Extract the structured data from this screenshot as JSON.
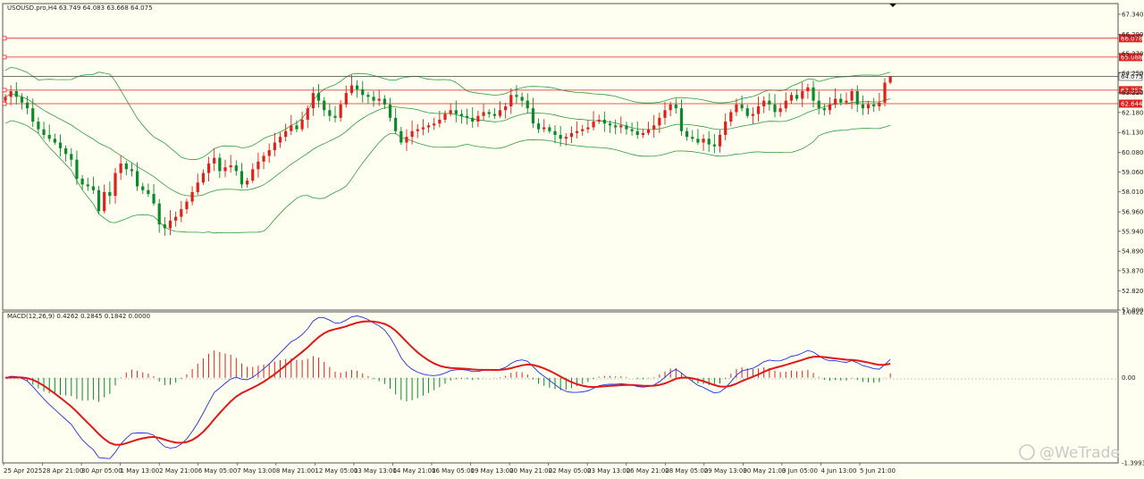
{
  "header": {
    "symbol_line": "USOUSD.pro,H4  63.749 64.083 63.668 64.075",
    "macd_line": "MACD(12,26,9) 0.4262 0.2845 0.1842 0.0000"
  },
  "watermark": "@WeTrade",
  "colors": {
    "background": "#fefff0",
    "bull": "#e0201c",
    "bear": "#0a8a2a",
    "bollinger": "#2e9e3e",
    "level": "#e02020",
    "price_line": "#444444",
    "macd": "#2030e0",
    "signal": "#e01818"
  },
  "chart_data": [
    {
      "type": "candlestick",
      "symbol": "USOUSD.pro",
      "timeframe": "H4",
      "ohlc_current": {
        "open": 63.749,
        "high": 64.083,
        "low": 63.668,
        "close": 64.075
      },
      "ylim": [
        51.8,
        67.9
      ],
      "y_ticks": [
        "67.340",
        "66.290",
        "65.270",
        "64.250",
        "63.220",
        "62.180",
        "61.130",
        "60.080",
        "59.060",
        "58.010",
        "56.960",
        "55.940",
        "54.890",
        "53.870",
        "52.820",
        "51.800"
      ],
      "x_ticks": [
        "25 Apr 2025",
        "28 Apr 21:00",
        "30 Apr 05:00",
        "1 May 13:00",
        "2 May 21:00",
        "6 May 05:00",
        "7 May 13:00",
        "8 May 21:00",
        "12 May 05:00",
        "13 May 13:00",
        "14 May 21:00",
        "16 May 05:00",
        "19 May 13:00",
        "20 May 21:00",
        "22 May 05:00",
        "23 May 13:00",
        "26 May 21:00",
        "28 May 05:00",
        "29 May 13:00",
        "30 May 21:00",
        "3 Jun 05:00",
        "4 Jun 13:00",
        "5 Jun 21:00"
      ],
      "levels": [
        {
          "value": 66.078,
          "label": "66.078"
        },
        {
          "value": 65.088,
          "label": "65.088"
        },
        {
          "value": 63.352,
          "label": "63.352"
        },
        {
          "value": 62.644,
          "label": "62.644"
        }
      ],
      "last_price": {
        "value": 64.075,
        "label": "64.075"
      },
      "close": [
        63.0,
        63.3,
        63.0,
        62.7,
        62.4,
        61.7,
        61.3,
        61.0,
        60.8,
        60.6,
        60.3,
        60.0,
        59.7,
        58.7,
        58.4,
        58.3,
        58.1,
        57.0,
        58.0,
        57.8,
        59.0,
        59.5,
        59.2,
        59.1,
        58.3,
        58.1,
        57.9,
        57.4,
        56.3,
        56.1,
        56.5,
        56.7,
        57.1,
        57.5,
        58.0,
        58.5,
        59.0,
        59.5,
        59.8,
        59.1,
        59.3,
        59.4,
        59.1,
        58.4,
        58.6,
        59.2,
        59.6,
        59.9,
        60.2,
        60.6,
        60.9,
        61.2,
        61.5,
        61.3,
        61.8,
        62.4,
        63.2,
        62.8,
        62.3,
        62.0,
        61.9,
        62.6,
        63.2,
        63.6,
        63.4,
        63.1,
        63.0,
        62.8,
        62.9,
        62.6,
        61.9,
        61.2,
        60.6,
        60.9,
        61.2,
        61.3,
        61.4,
        61.5,
        61.6,
        61.8,
        62.1,
        62.3,
        62.1,
        62.0,
        61.9,
        61.7,
        62.0,
        62.2,
        62.1,
        62.0,
        62.3,
        62.5,
        63.1,
        63.0,
        62.8,
        62.4,
        61.6,
        61.3,
        61.4,
        61.2,
        61.0,
        60.8,
        60.9,
        61.1,
        61.2,
        61.3,
        61.4,
        61.7,
        61.8,
        61.6,
        61.5,
        61.4,
        61.5,
        61.3,
        61.2,
        61.0,
        61.1,
        61.3,
        61.5,
        61.9,
        62.3,
        62.6,
        62.4,
        61.2,
        60.9,
        60.8,
        60.6,
        60.8,
        60.5,
        60.4,
        61.0,
        61.7,
        62.2,
        62.6,
        62.4,
        62.0,
        62.1,
        62.5,
        62.8,
        62.6,
        62.2,
        62.4,
        62.8,
        63.1,
        62.9,
        63.3,
        63.5,
        62.8,
        62.4,
        62.3,
        62.6,
        62.9,
        62.7,
        62.8,
        63.3,
        62.6,
        62.4,
        62.6,
        62.5,
        62.7,
        63.749,
        64.075
      ]
    },
    {
      "type": "line",
      "name": "MACD(12,26,9)",
      "values_text": "0.4262 0.2845 0.1842 0.0000",
      "ylim": [
        -1.3993,
        1.0822
      ],
      "y_ticks": [
        "1.0822",
        "0.00",
        "-1.3993"
      ]
    }
  ]
}
